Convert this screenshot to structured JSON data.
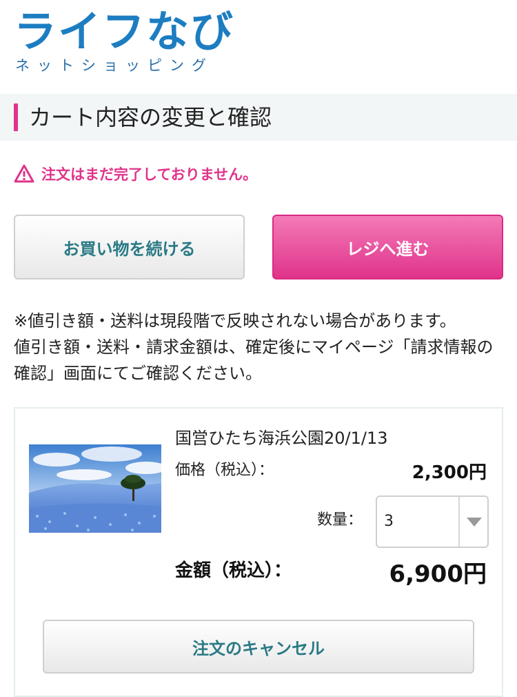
{
  "logo": {
    "main": "ライフなび",
    "sub": "ネットショッピング"
  },
  "page_title": "カート内容の変更と確認",
  "warning": {
    "icon": "warning-triangle-icon",
    "text": "注文はまだ完了しておりません。"
  },
  "buttons": {
    "continue_shopping": "お買い物を続ける",
    "checkout": "レジへ進む"
  },
  "notice": {
    "line1": "※値引き額・送料は現段階で反映されない場合があります。",
    "line2": "値引き額・送料・請求金額は、確定後にマイページ「請求情報の確認」画面にてご確認ください。"
  },
  "cart_item": {
    "name": "国営ひたち海浜公園20/1/13",
    "price_label": "価格（税込）：",
    "price_value": "2,300円",
    "quantity_label": "数量：",
    "quantity_value": "3",
    "total_label": "金額（税込）：",
    "total_value": "6,900円",
    "cancel_label": "注文のキャンセル"
  },
  "colors": {
    "accent": "#e0338a",
    "brand_blue": "#1d7dc1",
    "teal_text": "#2a7a85"
  }
}
